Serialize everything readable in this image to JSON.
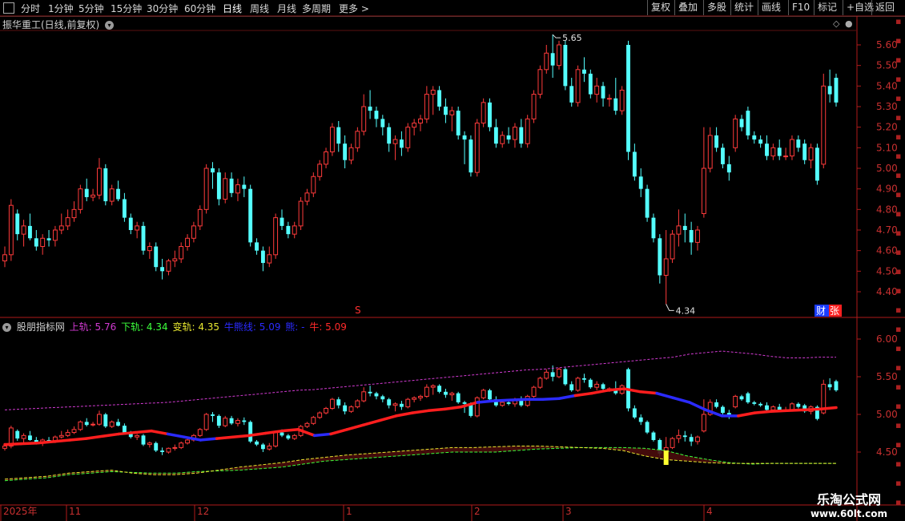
{
  "toolbar": {
    "left_tabs": [
      "分时",
      "1分钟",
      "5分钟",
      "15分钟",
      "30分钟",
      "60分钟",
      "日线",
      "周线",
      "月线",
      "多周期",
      "更多 >"
    ],
    "active_tab": "日线",
    "right_buttons": [
      "复权",
      "叠加",
      "多股",
      "统计",
      "画线",
      "F10",
      "标记",
      "+自选",
      "返回"
    ]
  },
  "main_chart": {
    "title": "振华重工(日线,前复权)",
    "price_axis": [
      "5.60",
      "5.50",
      "5.40",
      "5.30",
      "5.20",
      "5.10",
      "5.00",
      "4.90",
      "4.80",
      "4.70",
      "4.60",
      "4.50",
      "4.40"
    ],
    "high_marker": "5.65",
    "low_marker": "4.34",
    "tag_s": "S",
    "tag_cai": "财",
    "tag_zhang": "张"
  },
  "indicator": {
    "name": "股朋指标网",
    "upper_label": "上轨: 5.76",
    "lower_label": "下轨: 4.34",
    "change_label": "变轨: 4.35",
    "cow_bear_label": "牛熊线: 5.09",
    "bear_label": "熊: -",
    "bull_label": "牛: 5.09",
    "axis": [
      "6.00",
      "5.50",
      "5.00",
      "4.50"
    ]
  },
  "date_axis": {
    "labels": [
      "2025年",
      "11",
      "12",
      "1",
      "2",
      "3",
      "4"
    ]
  },
  "watermark": {
    "name": "乐淘公式网",
    "url": "www.60lt.com"
  },
  "colors": {
    "up": "#ff3b3b",
    "down": "#54ffff",
    "bull_line": "#ff1e1e",
    "bear_line": "#2b2bff",
    "upper": "#d13ad1",
    "lower": "#e8e830",
    "grid": "#8a1a1a"
  },
  "chart_data": {
    "type": "candlestick",
    "unit": "CNY",
    "y_range": [
      4.34,
      5.65
    ],
    "candles": [
      {
        "o": 4.55,
        "h": 4.62,
        "l": 4.52,
        "c": 4.58
      },
      {
        "o": 4.58,
        "h": 4.85,
        "l": 4.55,
        "c": 4.82
      },
      {
        "o": 4.78,
        "h": 4.8,
        "l": 4.65,
        "c": 4.68
      },
      {
        "o": 4.68,
        "h": 4.75,
        "l": 4.62,
        "c": 4.72
      },
      {
        "o": 4.72,
        "h": 4.78,
        "l": 4.65,
        "c": 4.66
      },
      {
        "o": 4.66,
        "h": 4.7,
        "l": 4.6,
        "c": 4.62
      },
      {
        "o": 4.62,
        "h": 4.68,
        "l": 4.58,
        "c": 4.66
      },
      {
        "o": 4.66,
        "h": 4.7,
        "l": 4.62,
        "c": 4.65
      },
      {
        "o": 4.65,
        "h": 4.72,
        "l": 4.62,
        "c": 4.7
      },
      {
        "o": 4.7,
        "h": 4.78,
        "l": 4.68,
        "c": 4.72
      },
      {
        "o": 4.72,
        "h": 4.8,
        "l": 4.7,
        "c": 4.76
      },
      {
        "o": 4.76,
        "h": 4.84,
        "l": 4.74,
        "c": 4.8
      },
      {
        "o": 4.8,
        "h": 4.92,
        "l": 4.78,
        "c": 4.9
      },
      {
        "o": 4.9,
        "h": 4.95,
        "l": 4.84,
        "c": 4.86
      },
      {
        "o": 4.86,
        "h": 4.9,
        "l": 4.84,
        "c": 4.87
      },
      {
        "o": 4.87,
        "h": 5.05,
        "l": 4.85,
        "c": 5.0
      },
      {
        "o": 5.0,
        "h": 5.02,
        "l": 4.82,
        "c": 4.84
      },
      {
        "o": 4.84,
        "h": 4.92,
        "l": 4.82,
        "c": 4.9
      },
      {
        "o": 4.9,
        "h": 4.94,
        "l": 4.84,
        "c": 4.85
      },
      {
        "o": 4.85,
        "h": 4.88,
        "l": 4.74,
        "c": 4.76
      },
      {
        "o": 4.76,
        "h": 4.78,
        "l": 4.68,
        "c": 4.7
      },
      {
        "o": 4.7,
        "h": 4.74,
        "l": 4.66,
        "c": 4.72
      },
      {
        "o": 4.72,
        "h": 4.74,
        "l": 4.58,
        "c": 4.6
      },
      {
        "o": 4.6,
        "h": 4.64,
        "l": 4.56,
        "c": 4.62
      },
      {
        "o": 4.62,
        "h": 4.64,
        "l": 4.5,
        "c": 4.52
      },
      {
        "o": 4.52,
        "h": 4.56,
        "l": 4.46,
        "c": 4.5
      },
      {
        "o": 4.5,
        "h": 4.56,
        "l": 4.48,
        "c": 4.55
      },
      {
        "o": 4.55,
        "h": 4.6,
        "l": 4.52,
        "c": 4.56
      },
      {
        "o": 4.56,
        "h": 4.64,
        "l": 4.54,
        "c": 4.62
      },
      {
        "o": 4.62,
        "h": 4.68,
        "l": 4.6,
        "c": 4.66
      },
      {
        "o": 4.66,
        "h": 4.74,
        "l": 4.64,
        "c": 4.72
      },
      {
        "o": 4.72,
        "h": 4.82,
        "l": 4.7,
        "c": 4.8
      },
      {
        "o": 4.8,
        "h": 5.02,
        "l": 4.78,
        "c": 5.0
      },
      {
        "o": 5.0,
        "h": 5.03,
        "l": 4.9,
        "c": 4.98
      },
      {
        "o": 4.98,
        "h": 5.0,
        "l": 4.82,
        "c": 4.85
      },
      {
        "o": 4.85,
        "h": 4.98,
        "l": 4.83,
        "c": 4.95
      },
      {
        "o": 4.95,
        "h": 4.98,
        "l": 4.86,
        "c": 4.88
      },
      {
        "o": 4.88,
        "h": 4.95,
        "l": 4.84,
        "c": 4.92
      },
      {
        "o": 4.92,
        "h": 4.96,
        "l": 4.86,
        "c": 4.9
      },
      {
        "o": 4.9,
        "h": 4.92,
        "l": 4.62,
        "c": 4.64
      },
      {
        "o": 4.64,
        "h": 4.66,
        "l": 4.58,
        "c": 4.6
      },
      {
        "o": 4.6,
        "h": 4.62,
        "l": 4.5,
        "c": 4.54
      },
      {
        "o": 4.54,
        "h": 4.62,
        "l": 4.52,
        "c": 4.58
      },
      {
        "o": 4.58,
        "h": 4.78,
        "l": 4.56,
        "c": 4.76
      },
      {
        "o": 4.76,
        "h": 4.8,
        "l": 4.7,
        "c": 4.72
      },
      {
        "o": 4.72,
        "h": 4.74,
        "l": 4.66,
        "c": 4.68
      },
      {
        "o": 4.68,
        "h": 4.74,
        "l": 4.66,
        "c": 4.72
      },
      {
        "o": 4.72,
        "h": 4.86,
        "l": 4.7,
        "c": 4.84
      },
      {
        "o": 4.84,
        "h": 4.9,
        "l": 4.82,
        "c": 4.88
      },
      {
        "o": 4.88,
        "h": 4.98,
        "l": 4.86,
        "c": 4.96
      },
      {
        "o": 4.96,
        "h": 5.04,
        "l": 4.94,
        "c": 5.02
      },
      {
        "o": 5.02,
        "h": 5.1,
        "l": 5.0,
        "c": 5.08
      },
      {
        "o": 5.08,
        "h": 5.22,
        "l": 5.06,
        "c": 5.2
      },
      {
        "o": 5.2,
        "h": 5.23,
        "l": 5.08,
        "c": 5.12
      },
      {
        "o": 5.12,
        "h": 5.16,
        "l": 5.0,
        "c": 5.04
      },
      {
        "o": 5.04,
        "h": 5.12,
        "l": 5.02,
        "c": 5.1
      },
      {
        "o": 5.1,
        "h": 5.2,
        "l": 5.08,
        "c": 5.18
      },
      {
        "o": 5.18,
        "h": 5.36,
        "l": 5.16,
        "c": 5.3
      },
      {
        "o": 5.3,
        "h": 5.38,
        "l": 5.24,
        "c": 5.28
      },
      {
        "o": 5.28,
        "h": 5.3,
        "l": 5.2,
        "c": 5.24
      },
      {
        "o": 5.24,
        "h": 5.26,
        "l": 5.16,
        "c": 5.2
      },
      {
        "o": 5.2,
        "h": 5.22,
        "l": 5.08,
        "c": 5.12
      },
      {
        "o": 5.12,
        "h": 5.16,
        "l": 5.04,
        "c": 5.14
      },
      {
        "o": 5.14,
        "h": 5.18,
        "l": 5.06,
        "c": 5.1
      },
      {
        "o": 5.1,
        "h": 5.22,
        "l": 5.08,
        "c": 5.2
      },
      {
        "o": 5.2,
        "h": 5.24,
        "l": 5.16,
        "c": 5.22
      },
      {
        "o": 5.22,
        "h": 5.26,
        "l": 5.18,
        "c": 5.24
      },
      {
        "o": 5.24,
        "h": 5.4,
        "l": 5.22,
        "c": 5.36
      },
      {
        "o": 5.36,
        "h": 5.4,
        "l": 5.26,
        "c": 5.38
      },
      {
        "o": 5.38,
        "h": 5.4,
        "l": 5.28,
        "c": 5.3
      },
      {
        "o": 5.3,
        "h": 5.34,
        "l": 5.22,
        "c": 5.26
      },
      {
        "o": 5.26,
        "h": 5.3,
        "l": 5.18,
        "c": 5.28
      },
      {
        "o": 5.28,
        "h": 5.3,
        "l": 5.14,
        "c": 5.16
      },
      {
        "o": 5.16,
        "h": 5.18,
        "l": 5.02,
        "c": 5.14
      },
      {
        "o": 5.14,
        "h": 5.16,
        "l": 4.96,
        "c": 4.98
      },
      {
        "o": 4.98,
        "h": 5.24,
        "l": 4.96,
        "c": 5.22
      },
      {
        "o": 5.22,
        "h": 5.34,
        "l": 5.2,
        "c": 5.32
      },
      {
        "o": 5.32,
        "h": 5.34,
        "l": 5.18,
        "c": 5.2
      },
      {
        "o": 5.2,
        "h": 5.24,
        "l": 5.1,
        "c": 5.12
      },
      {
        "o": 5.12,
        "h": 5.18,
        "l": 5.1,
        "c": 5.16
      },
      {
        "o": 5.16,
        "h": 5.2,
        "l": 5.12,
        "c": 5.14
      },
      {
        "o": 5.14,
        "h": 5.22,
        "l": 5.1,
        "c": 5.2
      },
      {
        "o": 5.2,
        "h": 5.24,
        "l": 5.1,
        "c": 5.12
      },
      {
        "o": 5.12,
        "h": 5.26,
        "l": 5.1,
        "c": 5.24
      },
      {
        "o": 5.24,
        "h": 5.38,
        "l": 5.22,
        "c": 5.36
      },
      {
        "o": 5.36,
        "h": 5.5,
        "l": 5.34,
        "c": 5.48
      },
      {
        "o": 5.48,
        "h": 5.6,
        "l": 5.46,
        "c": 5.56
      },
      {
        "o": 5.56,
        "h": 5.65,
        "l": 5.44,
        "c": 5.5
      },
      {
        "o": 5.5,
        "h": 5.62,
        "l": 5.48,
        "c": 5.6
      },
      {
        "o": 5.6,
        "h": 5.62,
        "l": 5.38,
        "c": 5.4
      },
      {
        "o": 5.4,
        "h": 5.44,
        "l": 5.3,
        "c": 5.32
      },
      {
        "o": 5.32,
        "h": 5.5,
        "l": 5.3,
        "c": 5.48
      },
      {
        "o": 5.48,
        "h": 5.54,
        "l": 5.42,
        "c": 5.46
      },
      {
        "o": 5.46,
        "h": 5.48,
        "l": 5.34,
        "c": 5.36
      },
      {
        "o": 5.36,
        "h": 5.44,
        "l": 5.32,
        "c": 5.4
      },
      {
        "o": 5.4,
        "h": 5.42,
        "l": 5.3,
        "c": 5.34
      },
      {
        "o": 5.34,
        "h": 5.36,
        "l": 5.3,
        "c": 5.34
      },
      {
        "o": 5.34,
        "h": 5.44,
        "l": 5.26,
        "c": 5.28
      },
      {
        "o": 5.28,
        "h": 5.4,
        "l": 5.26,
        "c": 5.38
      },
      {
        "o": 5.6,
        "h": 5.62,
        "l": 5.04,
        "c": 5.08
      },
      {
        "o": 5.08,
        "h": 5.12,
        "l": 4.94,
        "c": 4.96
      },
      {
        "o": 4.96,
        "h": 5.0,
        "l": 4.86,
        "c": 4.9
      },
      {
        "o": 4.9,
        "h": 4.92,
        "l": 4.74,
        "c": 4.76
      },
      {
        "o": 4.76,
        "h": 4.78,
        "l": 4.64,
        "c": 4.66
      },
      {
        "o": 4.66,
        "h": 4.68,
        "l": 4.44,
        "c": 4.48
      },
      {
        "o": 4.48,
        "h": 4.7,
        "l": 4.34,
        "c": 4.56
      },
      {
        "o": 4.56,
        "h": 4.7,
        "l": 4.54,
        "c": 4.68
      },
      {
        "o": 4.68,
        "h": 4.8,
        "l": 4.62,
        "c": 4.72
      },
      {
        "o": 4.72,
        "h": 4.78,
        "l": 4.64,
        "c": 4.7
      },
      {
        "o": 4.7,
        "h": 4.74,
        "l": 4.58,
        "c": 4.64
      },
      {
        "o": 4.64,
        "h": 4.72,
        "l": 4.6,
        "c": 4.7
      },
      {
        "o": 4.78,
        "h": 5.2,
        "l": 4.76,
        "c": 5.0
      },
      {
        "o": 5.0,
        "h": 5.2,
        "l": 4.98,
        "c": 5.16
      },
      {
        "o": 5.16,
        "h": 5.2,
        "l": 5.08,
        "c": 5.1
      },
      {
        "o": 5.1,
        "h": 5.12,
        "l": 5.0,
        "c": 5.02
      },
      {
        "o": 5.02,
        "h": 5.06,
        "l": 4.94,
        "c": 4.98
      },
      {
        "o": 5.1,
        "h": 5.26,
        "l": 5.08,
        "c": 5.24
      },
      {
        "o": 5.24,
        "h": 5.26,
        "l": 5.18,
        "c": 5.2
      },
      {
        "o": 5.28,
        "h": 5.3,
        "l": 5.14,
        "c": 5.16
      },
      {
        "o": 5.16,
        "h": 5.18,
        "l": 5.12,
        "c": 5.14
      },
      {
        "o": 5.14,
        "h": 5.16,
        "l": 5.1,
        "c": 5.12
      },
      {
        "o": 5.12,
        "h": 5.16,
        "l": 5.04,
        "c": 5.06
      },
      {
        "o": 5.06,
        "h": 5.12,
        "l": 5.04,
        "c": 5.1
      },
      {
        "o": 5.1,
        "h": 5.14,
        "l": 5.04,
        "c": 5.06
      },
      {
        "o": 5.06,
        "h": 5.1,
        "l": 5.04,
        "c": 5.06
      },
      {
        "o": 5.06,
        "h": 5.16,
        "l": 5.04,
        "c": 5.14
      },
      {
        "o": 5.14,
        "h": 5.16,
        "l": 5.08,
        "c": 5.1
      },
      {
        "o": 5.12,
        "h": 5.14,
        "l": 5.02,
        "c": 5.04
      },
      {
        "o": 5.04,
        "h": 5.12,
        "l": 5.0,
        "c": 5.1
      },
      {
        "o": 5.1,
        "h": 5.12,
        "l": 4.92,
        "c": 4.94
      },
      {
        "o": 5.02,
        "h": 5.46,
        "l": 5.0,
        "c": 5.4
      },
      {
        "o": 5.4,
        "h": 5.48,
        "l": 5.32,
        "c": 5.36
      },
      {
        "o": 5.44,
        "h": 5.46,
        "l": 5.3,
        "c": 5.32
      }
    ],
    "indicator_lines": {
      "upper": [
        5.06,
        5.07,
        5.08,
        5.09,
        5.1,
        5.11,
        5.12,
        5.13,
        5.14,
        5.15,
        5.16,
        5.18,
        5.2,
        5.22,
        5.24,
        5.26,
        5.28,
        5.3,
        5.32,
        5.33,
        5.35,
        5.37,
        5.39,
        5.41,
        5.43,
        5.45,
        5.47,
        5.49,
        5.51,
        5.53,
        5.55,
        5.57,
        5.59,
        5.6,
        5.62,
        5.64,
        5.66,
        5.68,
        5.7,
        5.72,
        5.74,
        5.76,
        5.8,
        5.82,
        5.84,
        5.82,
        5.8,
        5.77,
        5.75,
        5.75,
        5.76,
        5.76
      ],
      "bull_bear": [
        4.6,
        4.61,
        4.62,
        4.64,
        4.66,
        4.68,
        4.71,
        4.74,
        4.76,
        4.78,
        4.74,
        4.7,
        4.66,
        4.68,
        4.7,
        4.72,
        4.75,
        4.78,
        4.8,
        4.72,
        4.74,
        4.8,
        4.86,
        4.92,
        4.98,
        5.02,
        5.05,
        5.07,
        5.1,
        5.16,
        5.18,
        5.19,
        5.2,
        5.2,
        5.21,
        5.25,
        5.28,
        5.32,
        5.34,
        5.3,
        5.28,
        5.22,
        5.16,
        5.06,
        4.98,
        4.98,
        5.02,
        5.04,
        5.05,
        5.06,
        5.07,
        5.09
      ],
      "bull_bear_sides": [
        "bull",
        "bull",
        "bull",
        "bull",
        "bull",
        "bull",
        "bull",
        "bull",
        "bull",
        "bull",
        "bear",
        "bear",
        "bear",
        "bull",
        "bull",
        "bull",
        "bull",
        "bull",
        "bull",
        "bear",
        "bull",
        "bull",
        "bull",
        "bull",
        "bull",
        "bull",
        "bull",
        "bull",
        "bull",
        "bear",
        "bear",
        "bear",
        "bear",
        "bear",
        "bear",
        "bull",
        "bull",
        "bull",
        "bull",
        "bull",
        "bear",
        "bear",
        "bear",
        "bear",
        "bear",
        "bull",
        "bull",
        "bull",
        "bull",
        "bull",
        "bull",
        "bull"
      ],
      "lower": [
        4.12,
        4.14,
        4.16,
        4.2,
        4.22,
        4.24,
        4.23,
        4.22,
        4.22,
        4.24,
        4.25,
        4.26,
        4.28,
        4.3,
        4.34,
        4.38,
        4.4,
        4.42,
        4.44,
        4.46,
        4.48,
        4.5,
        4.5,
        4.5,
        4.52,
        4.54,
        4.55,
        4.56,
        4.56,
        4.56,
        4.55,
        4.52,
        4.45,
        4.4,
        4.36,
        4.34,
        4.35,
        4.35,
        4.35,
        4.35
      ],
      "change": [
        4.14,
        4.16,
        4.18,
        4.22,
        4.24,
        4.26,
        4.22,
        4.2,
        4.2,
        4.22,
        4.26,
        4.3,
        4.33,
        4.36,
        4.4,
        4.43,
        4.46,
        4.48,
        4.5,
        4.52,
        4.54,
        4.56,
        4.56,
        4.57,
        4.58,
        4.58,
        4.57,
        4.56,
        4.55,
        4.52,
        4.45,
        4.4,
        4.38,
        4.36,
        4.35,
        4.35,
        4.35,
        4.35,
        4.35,
        4.35
      ]
    }
  }
}
